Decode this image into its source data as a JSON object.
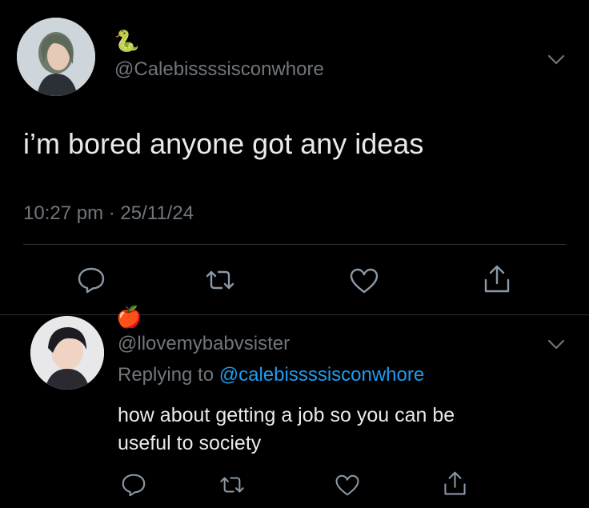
{
  "tweet": {
    "display_name_emoji": "🐍",
    "handle": "@Calebissssisconwhore",
    "text": "i’m bored anyone got any ideas",
    "timestamp": "10:27 pm · 25/11/24"
  },
  "reply": {
    "display_name_emoji": "🍎",
    "handle": "@llovemybabvsister",
    "replying_prefix": "Replying to",
    "replying_handle": "@calebissssisconwhore",
    "text_line1": "how about getting a job so you can be",
    "text_line2": "useful to society"
  },
  "icons": {
    "reply": "reply-icon",
    "retweet": "retweet-icon",
    "like": "heart-icon",
    "share": "share-icon",
    "more": "chevron-down-icon"
  },
  "colors": {
    "background": "#000000",
    "text": "#e7e9ea",
    "muted": "#71767b",
    "link": "#1d9bf0",
    "divider": "#2f3336"
  }
}
